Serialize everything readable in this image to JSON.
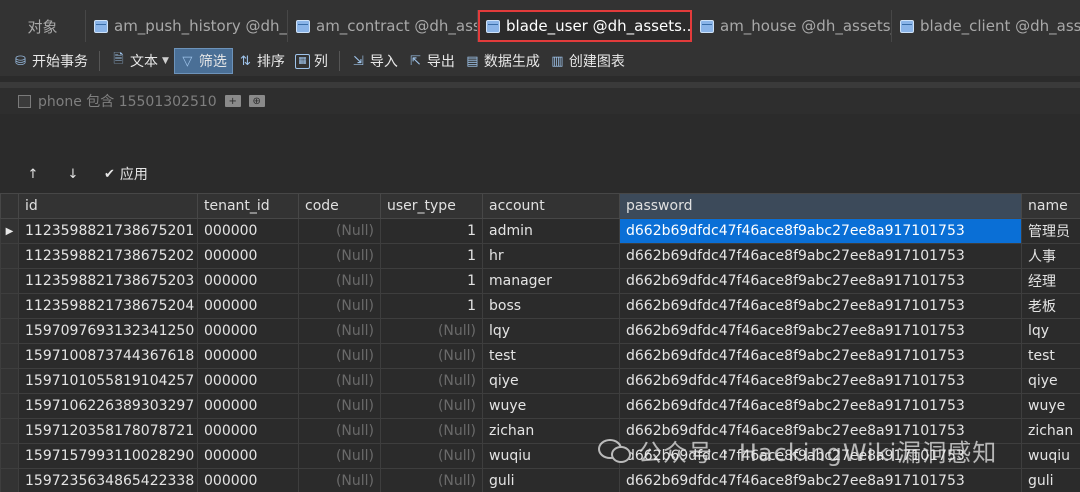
{
  "tabs": [
    {
      "label": "对象",
      "active": false
    },
    {
      "label": "am_push_history @dh_assets_...",
      "active": false
    },
    {
      "label": "am_contract @dh_asse...",
      "active": false
    },
    {
      "label": "blade_user @dh_assets...",
      "active": true
    },
    {
      "label": "am_house @dh_assets_...",
      "active": false
    },
    {
      "label": "blade_client @dh_asset",
      "active": false
    }
  ],
  "toolbar": {
    "begin_transaction": "开始事务",
    "text": "文本",
    "filter": "筛选",
    "sort": "排序",
    "columns": "列",
    "import": "导入",
    "export": "导出",
    "generate_data": "数据生成",
    "create_chart": "创建图表"
  },
  "filter": {
    "expression": "phone 包含 15501302510",
    "add_label": "+",
    "add_group_label": "⊕"
  },
  "apply_row": {
    "up": "↑",
    "down": "↓",
    "apply": "应用"
  },
  "grid": {
    "columns": [
      "id",
      "tenant_id",
      "code",
      "user_type",
      "account",
      "password",
      "name"
    ],
    "rows": [
      [
        "1123598821738675201",
        "000000",
        "(Null)",
        "1",
        "admin",
        "d662b69dfdc47f46ace8f9abc27ee8a917101753",
        "管理员"
      ],
      [
        "1123598821738675202",
        "000000",
        "(Null)",
        "1",
        "hr",
        "d662b69dfdc47f46ace8f9abc27ee8a917101753",
        "人事"
      ],
      [
        "1123598821738675203",
        "000000",
        "(Null)",
        "1",
        "manager",
        "d662b69dfdc47f46ace8f9abc27ee8a917101753",
        "经理"
      ],
      [
        "1123598821738675204",
        "000000",
        "(Null)",
        "1",
        "boss",
        "d662b69dfdc47f46ace8f9abc27ee8a917101753",
        "老板"
      ],
      [
        "1597097693132341250",
        "000000",
        "(Null)",
        "(Null)",
        "lqy",
        "d662b69dfdc47f46ace8f9abc27ee8a917101753",
        "lqy"
      ],
      [
        "1597100873744367618",
        "000000",
        "(Null)",
        "(Null)",
        "test",
        "d662b69dfdc47f46ace8f9abc27ee8a917101753",
        "test"
      ],
      [
        "1597101055819104257",
        "000000",
        "(Null)",
        "(Null)",
        "qiye",
        "d662b69dfdc47f46ace8f9abc27ee8a917101753",
        "qiye"
      ],
      [
        "1597106226389303297",
        "000000",
        "(Null)",
        "(Null)",
        "wuye",
        "d662b69dfdc47f46ace8f9abc27ee8a917101753",
        "wuye"
      ],
      [
        "1597120358178078721",
        "000000",
        "(Null)",
        "(Null)",
        "zichan",
        "d662b69dfdc47f46ace8f9abc27ee8a917101753",
        "zichan"
      ],
      [
        "1597157993110028290",
        "000000",
        "(Null)",
        "(Null)",
        "wuqiu",
        "d662b69dfdc47f46ace8f9abc27ee8a917101753",
        "wuqiu"
      ],
      [
        "1597235634865422338",
        "000000",
        "(Null)",
        "(Null)",
        "guli",
        "d662b69dfdc47f46ace8f9abc27ee8a917101753",
        "guli"
      ]
    ],
    "current_row_marker": "▶"
  },
  "watermark": "公众号 · HackingWiki漏洞感知",
  "colors": {
    "selected_cell": "#0a6fd6",
    "active_tab_outline": "#e23b3b",
    "null_text": "#6a6a6a"
  }
}
